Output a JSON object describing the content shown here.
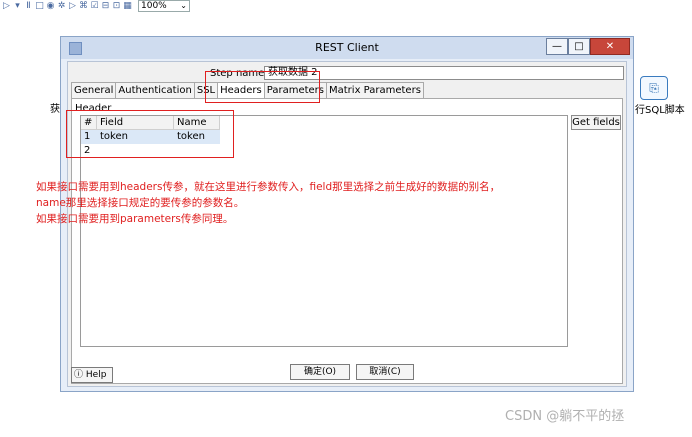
{
  "toolbar": {
    "icons": [
      "play-icon",
      "dropdown-icon",
      "pause-icon",
      "stop-icon",
      "preview-icon",
      "debug-icon",
      "replay-icon",
      "explore-icon",
      "check-icon",
      "sql-icon",
      "impact-icon",
      "grid-icon"
    ],
    "zoom": "100%"
  },
  "canvas": {
    "left_step_label": "获",
    "right_step_label": "行SQL脚本"
  },
  "dialog": {
    "title": "REST Client",
    "controls": {
      "minimize": "—",
      "maximize": "□",
      "close": "✕"
    },
    "step_name_label": "Step name",
    "step_name_value": "获取数据 2",
    "tabs": [
      "General",
      "Authentication",
      "SSL",
      "Headers",
      "Parameters",
      "Matrix Parameters"
    ],
    "active_tab": "Headers",
    "group_label": "Header",
    "table": {
      "columns": [
        "#",
        "Field",
        "Name"
      ],
      "rows": [
        {
          "index": "1",
          "field": "token",
          "name": "token"
        },
        {
          "index": "2",
          "field": "",
          "name": ""
        }
      ]
    },
    "get_fields_button": "Get fields",
    "ok_button": "确定(O)",
    "cancel_button": "取消(C)",
    "help_button": "Help"
  },
  "annotation": {
    "lines": [
      "如果接口需要用到headers传参，就在这里进行参数传入，field那里选择之前生成好的数据的别名，",
      "name那里选择接口规定的要传参的参数名。",
      "如果接口需要用到parameters传参同理。"
    ],
    "color": "#e02020"
  },
  "watermark": "CSDN @躺不平的拯"
}
